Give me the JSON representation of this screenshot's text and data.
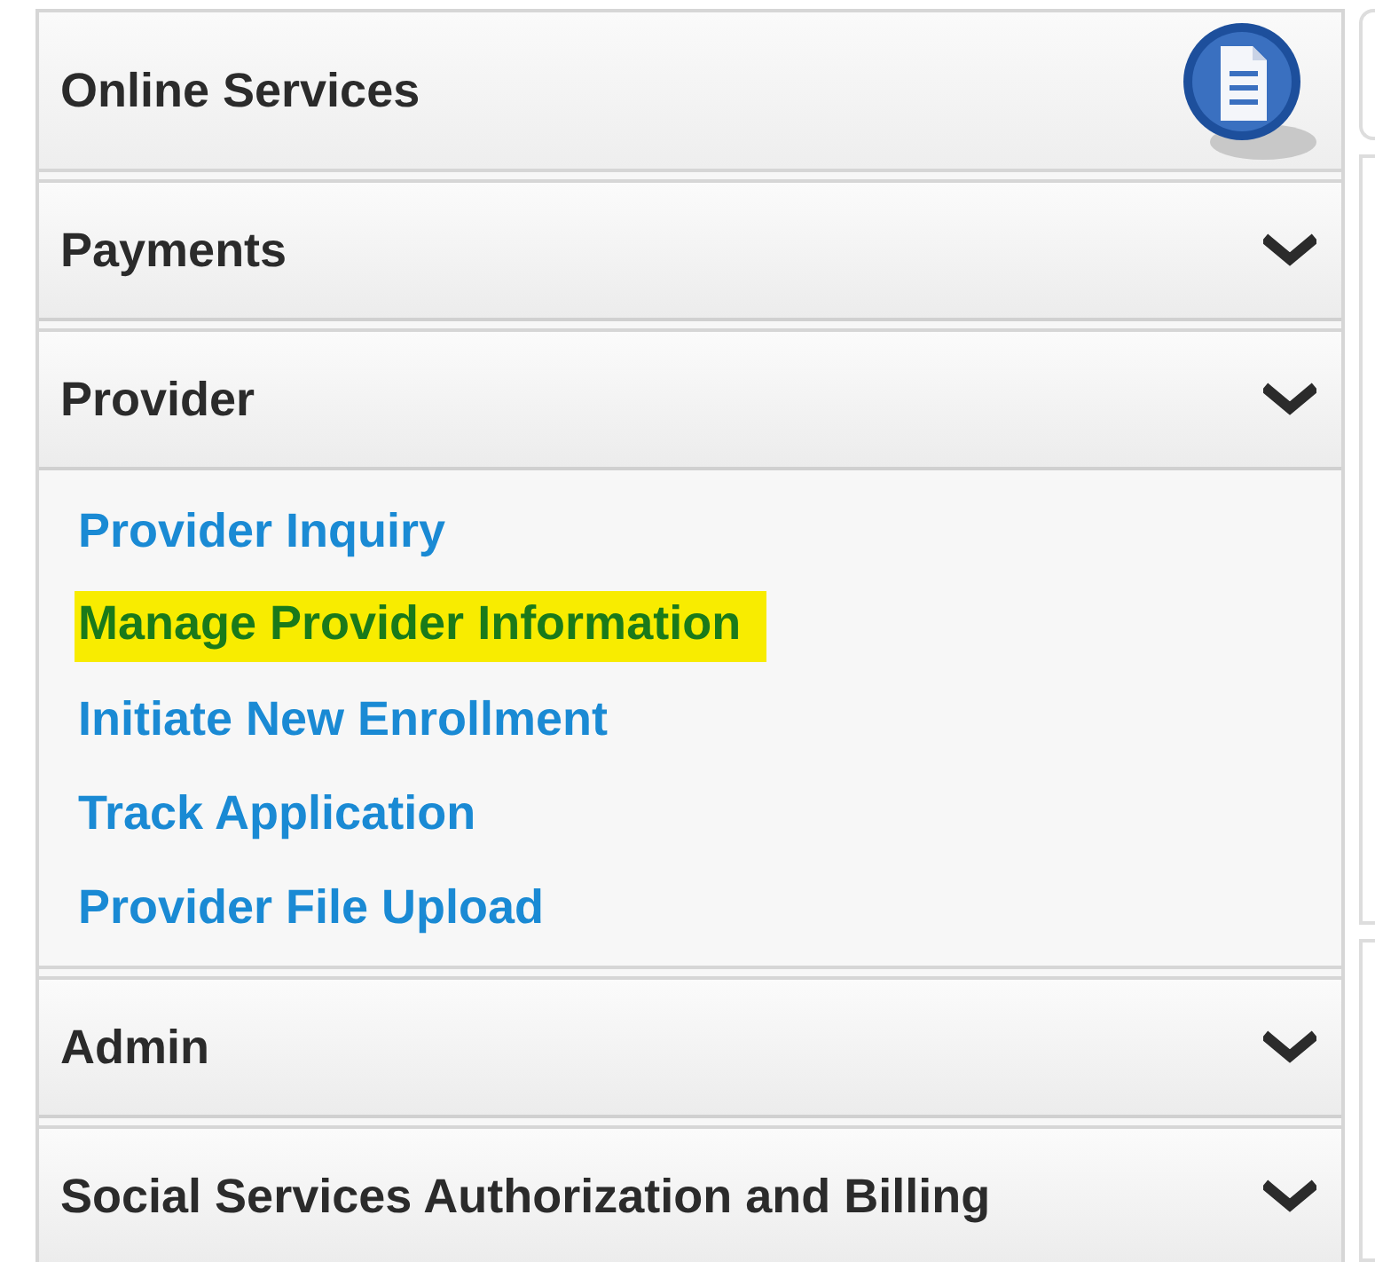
{
  "panel": {
    "title": "Online Services"
  },
  "sections": [
    {
      "title": "Payments"
    },
    {
      "title": "Provider",
      "links": [
        {
          "label": "Provider Inquiry",
          "highlighted": false
        },
        {
          "label": "Manage Provider Information",
          "highlighted": true
        },
        {
          "label": "Initiate New Enrollment",
          "highlighted": false
        },
        {
          "label": "Track Application",
          "highlighted": false
        },
        {
          "label": "Provider File Upload",
          "highlighted": false
        }
      ]
    },
    {
      "title": "Admin"
    },
    {
      "title": "Social Services Authorization and Billing"
    }
  ]
}
